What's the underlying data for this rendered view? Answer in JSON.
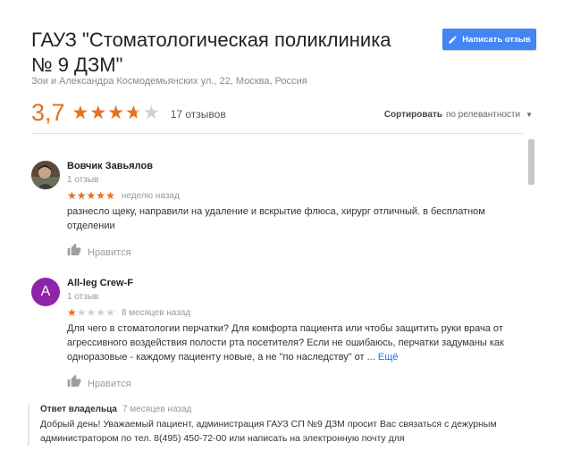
{
  "place": {
    "title": "ГАУЗ \"Стоматологическая поликлиника № 9 ДЗМ\"",
    "address": "Зои и Александра Космодемьянских ул., 22, Москва, Россия",
    "rating_text": "3,7",
    "rating_value": 3.7,
    "review_count": "17 отзывов"
  },
  "actions": {
    "write_review": "Написать отзыв",
    "sort_label": "Сортировать",
    "sort_value": "по релевантности"
  },
  "colors": {
    "accent": "#4285f4",
    "star": "#e7711b",
    "star_empty": "#d0d0d0",
    "avatar_letter_bg": "#8e24aa",
    "link": "#1a73e8"
  },
  "reviews": [
    {
      "name": "Вовчик Завьялов",
      "sub": "1 отзыв",
      "stars": 5,
      "date": "неделю назад",
      "text": "разнесло щеку, направили на удаление и вскрытие флюса, хирург отличный. в бесплатном отделении",
      "like": "Нравится",
      "avatar": "photo"
    },
    {
      "name": "All-leg Crew-F",
      "sub": "1 отзыв",
      "stars": 1,
      "date": "8 месяцев назад",
      "text": "Для чего в стоматологии перчатки? Для комфорта пациента или чтобы защитить руки врача от агрессивного воздействия полости рта посетителя? Если не ошибаюсь, перчатки задуманы как одноразовые - каждому пациенту новые, а не \"по наследству\" от ...",
      "more": "Ещё",
      "like": "Нравится",
      "avatar_letter": "A"
    }
  ],
  "owner_reply": {
    "title": "Ответ владельца",
    "date": "7 месяцев назад",
    "text": "Добрый день! Уважаемый пациент, администрация ГАУЗ СП №9 ДЗМ просит Вас связаться с дежурным администратором по тел. 8(495) 450-72-00 или написать на электронную почту для"
  }
}
